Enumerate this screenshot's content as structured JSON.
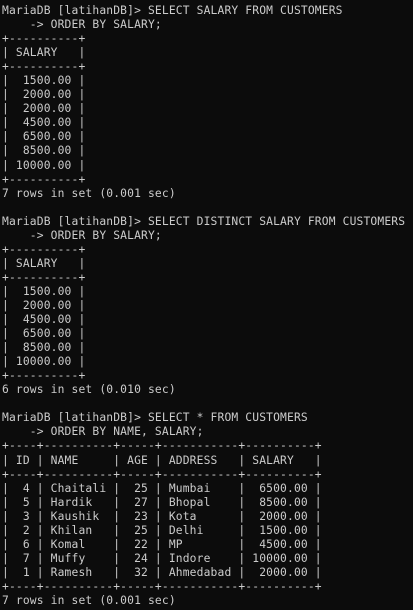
{
  "lines": [
    "MariaDB [latihanDB]> SELECT SALARY FROM CUSTOMERS",
    "    -> ORDER BY SALARY;",
    "+----------+",
    "| SALARY   |",
    "+----------+",
    "|  1500.00 |",
    "|  2000.00 |",
    "|  2000.00 |",
    "|  4500.00 |",
    "|  6500.00 |",
    "|  8500.00 |",
    "| 10000.00 |",
    "+----------+",
    "7 rows in set (0.001 sec)",
    "",
    "MariaDB [latihanDB]> SELECT DISTINCT SALARY FROM CUSTOMERS",
    "    -> ORDER BY SALARY;",
    "+----------+",
    "| SALARY   |",
    "+----------+",
    "|  1500.00 |",
    "|  2000.00 |",
    "|  4500.00 |",
    "|  6500.00 |",
    "|  8500.00 |",
    "| 10000.00 |",
    "+----------+",
    "6 rows in set (0.010 sec)",
    "",
    "MariaDB [latihanDB]> SELECT * FROM CUSTOMERS",
    "    -> ORDER BY NAME, SALARY;",
    "+----+----------+-----+-----------+----------+",
    "| ID | NAME     | AGE | ADDRESS   | SALARY   |",
    "+----+----------+-----+-----------+----------+",
    "|  4 | Chaitali |  25 | Mumbai    |  6500.00 |",
    "|  5 | Hardik   |  27 | Bhopal    |  8500.00 |",
    "|  3 | Kaushik  |  23 | Kota      |  2000.00 |",
    "|  2 | Khilan   |  25 | Delhi     |  1500.00 |",
    "|  6 | Komal    |  22 | MP        |  4500.00 |",
    "|  7 | Muffy    |  24 | Indore    | 10000.00 |",
    "|  1 | Ramesh   |  32 | Ahmedabad |  2000.00 |",
    "+----+----------+-----+-----------+----------+",
    "7 rows in set (0.001 sec)"
  ]
}
